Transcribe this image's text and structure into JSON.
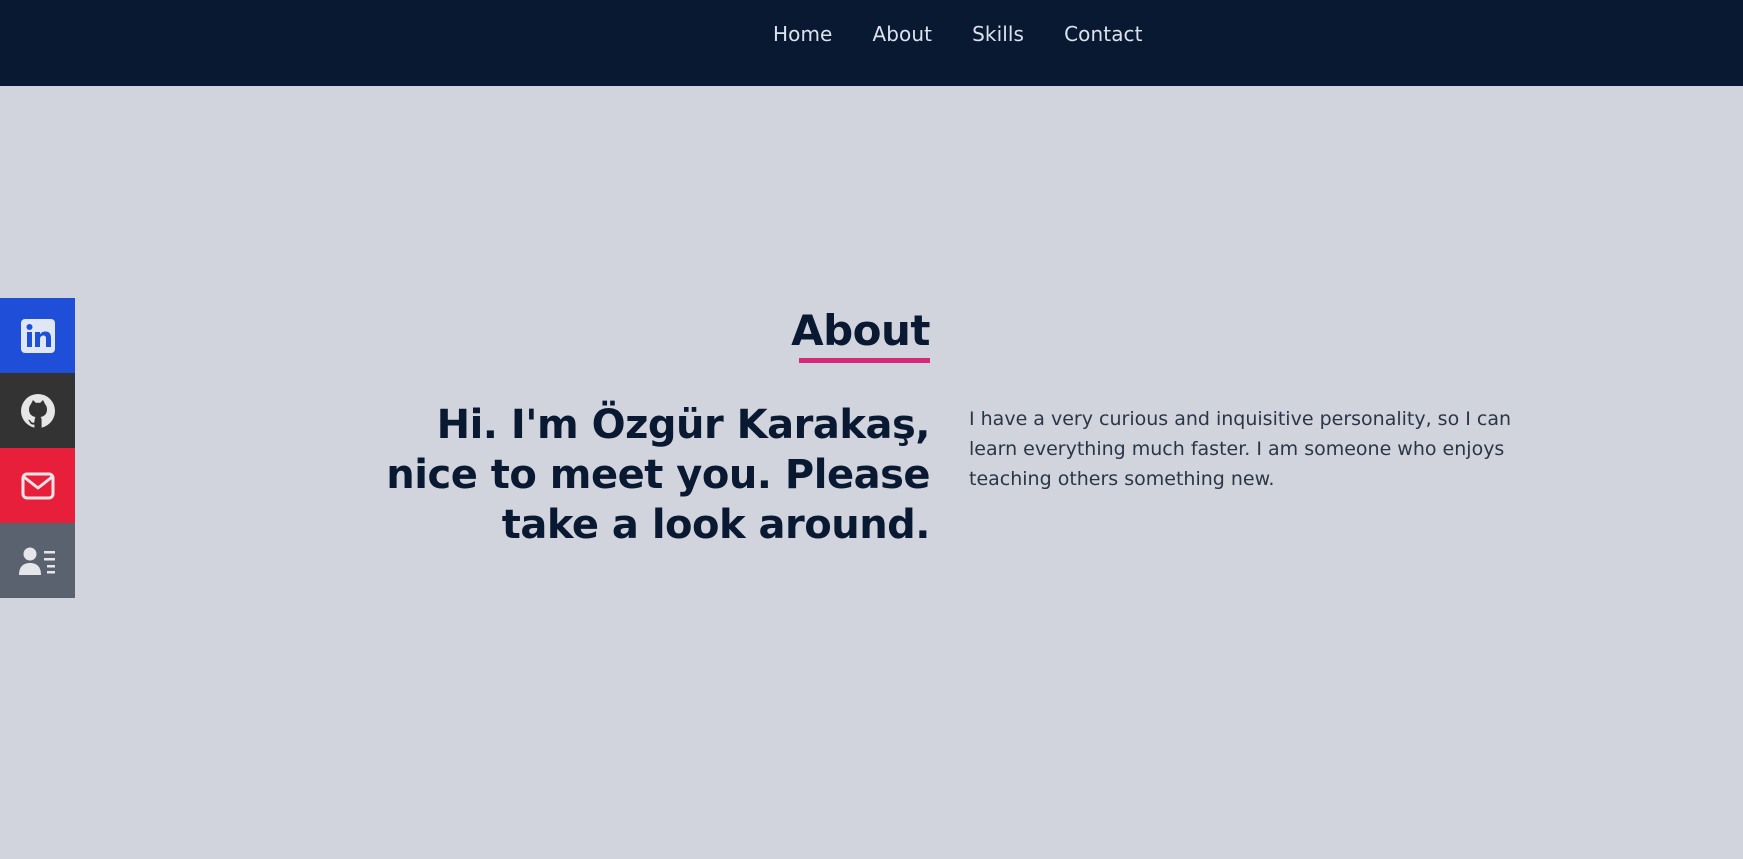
{
  "nav": {
    "items": [
      {
        "label": "Home"
      },
      {
        "label": "About"
      },
      {
        "label": "Skills"
      },
      {
        "label": "Contact"
      }
    ]
  },
  "social": [
    {
      "icon": "linkedin-icon",
      "color": "#1f4ed8"
    },
    {
      "icon": "github-icon",
      "color": "#333333"
    },
    {
      "icon": "mail-icon",
      "color": "#e81f3a"
    },
    {
      "icon": "contact-card-icon",
      "color": "#5a6270"
    }
  ],
  "about": {
    "heading": "About",
    "intro": "Hi. I'm Özgür Karakaş, nice to meet you. Please take a look around.",
    "bio": "I have a very curious and inquisitive personality, so I can learn everything much faster. I am someone who enjoys teaching others something new."
  },
  "colors": {
    "navbar": "#0a1932",
    "background": "#d1d4dd",
    "accent": "#d6297a"
  }
}
